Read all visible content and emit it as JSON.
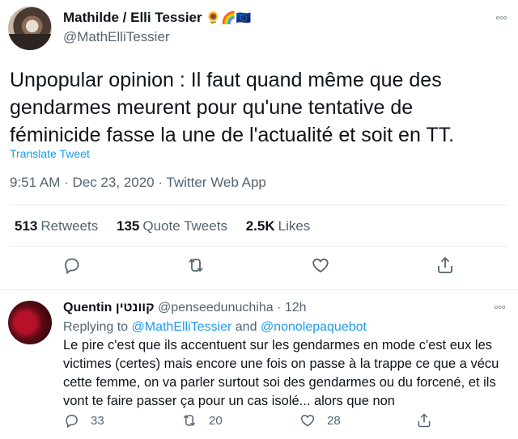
{
  "tweet": {
    "author": {
      "display_name": "Mathilde / Elli Tessier",
      "name_emoji": "🌻🌈🇪🇺",
      "handle": "@MathElliTessier"
    },
    "more_icon": "more-dots",
    "text": "Unpopular opinion : Il faut quand même que des gendarmes meurent pour qu'une tentative de féminicide fasse la une de l'actualité et soit en TT.",
    "translate_label": "Translate Tweet",
    "timestamp": "9:51 AM · Dec 23, 2020 · Twitter Web App",
    "stats": {
      "retweets_count": "513",
      "retweets_label": "Retweets",
      "quotes_count": "135",
      "quotes_label": "Quote Tweets",
      "likes_count": "2.5K",
      "likes_label": "Likes"
    },
    "actions": [
      "reply-icon",
      "retweet-icon",
      "like-icon",
      "share-icon"
    ]
  },
  "reply": {
    "display_name": "Quentin קוונטין",
    "handle_time": "@penseedunuchiha · 12h",
    "replying_prefix": "Replying to",
    "replying_mention_1": "@MathElliTessier",
    "replying_and": "and",
    "replying_mention_2": "@nonolepaquebot",
    "text": "Le pire c'est que ils accentuent sur les gendarmes en mode c'est eux les victimes (certes) mais encore une fois on passe à la trappe ce que a vécu cette femme, on va parler surtout soi des gendarmes ou du forcené, et ils vont te faire passer ça pour un cas isolé... alors que non",
    "counts": {
      "replies": "33",
      "retweets": "20",
      "likes": "28"
    }
  },
  "colors": {
    "link": "#1d9bf0",
    "secondary_text": "#536471",
    "divider": "#e6ecf0"
  }
}
